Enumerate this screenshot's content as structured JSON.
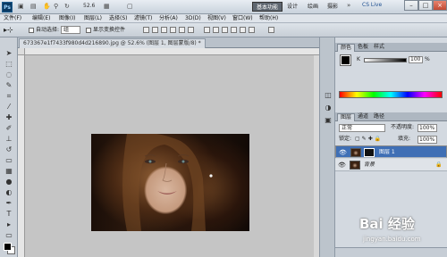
{
  "app": {
    "logo": "Ps",
    "zoom": "52.6"
  },
  "workspaces": [
    {
      "label": "基本功能",
      "active": true
    },
    {
      "label": "设计",
      "active": false
    },
    {
      "label": "绘画",
      "active": false
    },
    {
      "label": "摄影",
      "active": false
    }
  ],
  "cslive": "CS Live",
  "menu": [
    "文件(F)",
    "编辑(E)",
    "图像(I)",
    "图层(L)",
    "选择(S)",
    "滤镜(T)",
    "分析(A)",
    "3D(D)",
    "视图(V)",
    "窗口(W)",
    "帮助(H)"
  ],
  "options": {
    "auto_select": "自动选择:",
    "auto_select_value": "组",
    "show_transform": "显示变换控件"
  },
  "document": {
    "tab": "673367e1f7433f980d4d216890.jpg @ 52.6% (图层 1, 图层蒙版/8) *"
  },
  "panels": {
    "top_tabs": [
      "颜色",
      "色板",
      "样式"
    ],
    "k_label": "K",
    "k_value": "100",
    "k_unit": "%",
    "layer_tabs": [
      "图层",
      "通道",
      "路径"
    ],
    "blend_mode": "正常",
    "opacity_label": "不透明度:",
    "opacity_value": "100%",
    "lock_label": "锁定:",
    "fill_label": "填充:",
    "fill_value": "100%",
    "layers": [
      {
        "name": "图层 1",
        "selected": true
      },
      {
        "name": "背景",
        "selected": false
      }
    ]
  },
  "watermark": {
    "brand": "Bai 经验",
    "url": "jingyan.baidu.com"
  },
  "colors": {
    "accent": "#3f6fb5",
    "canvas": "#c5c5c5"
  }
}
